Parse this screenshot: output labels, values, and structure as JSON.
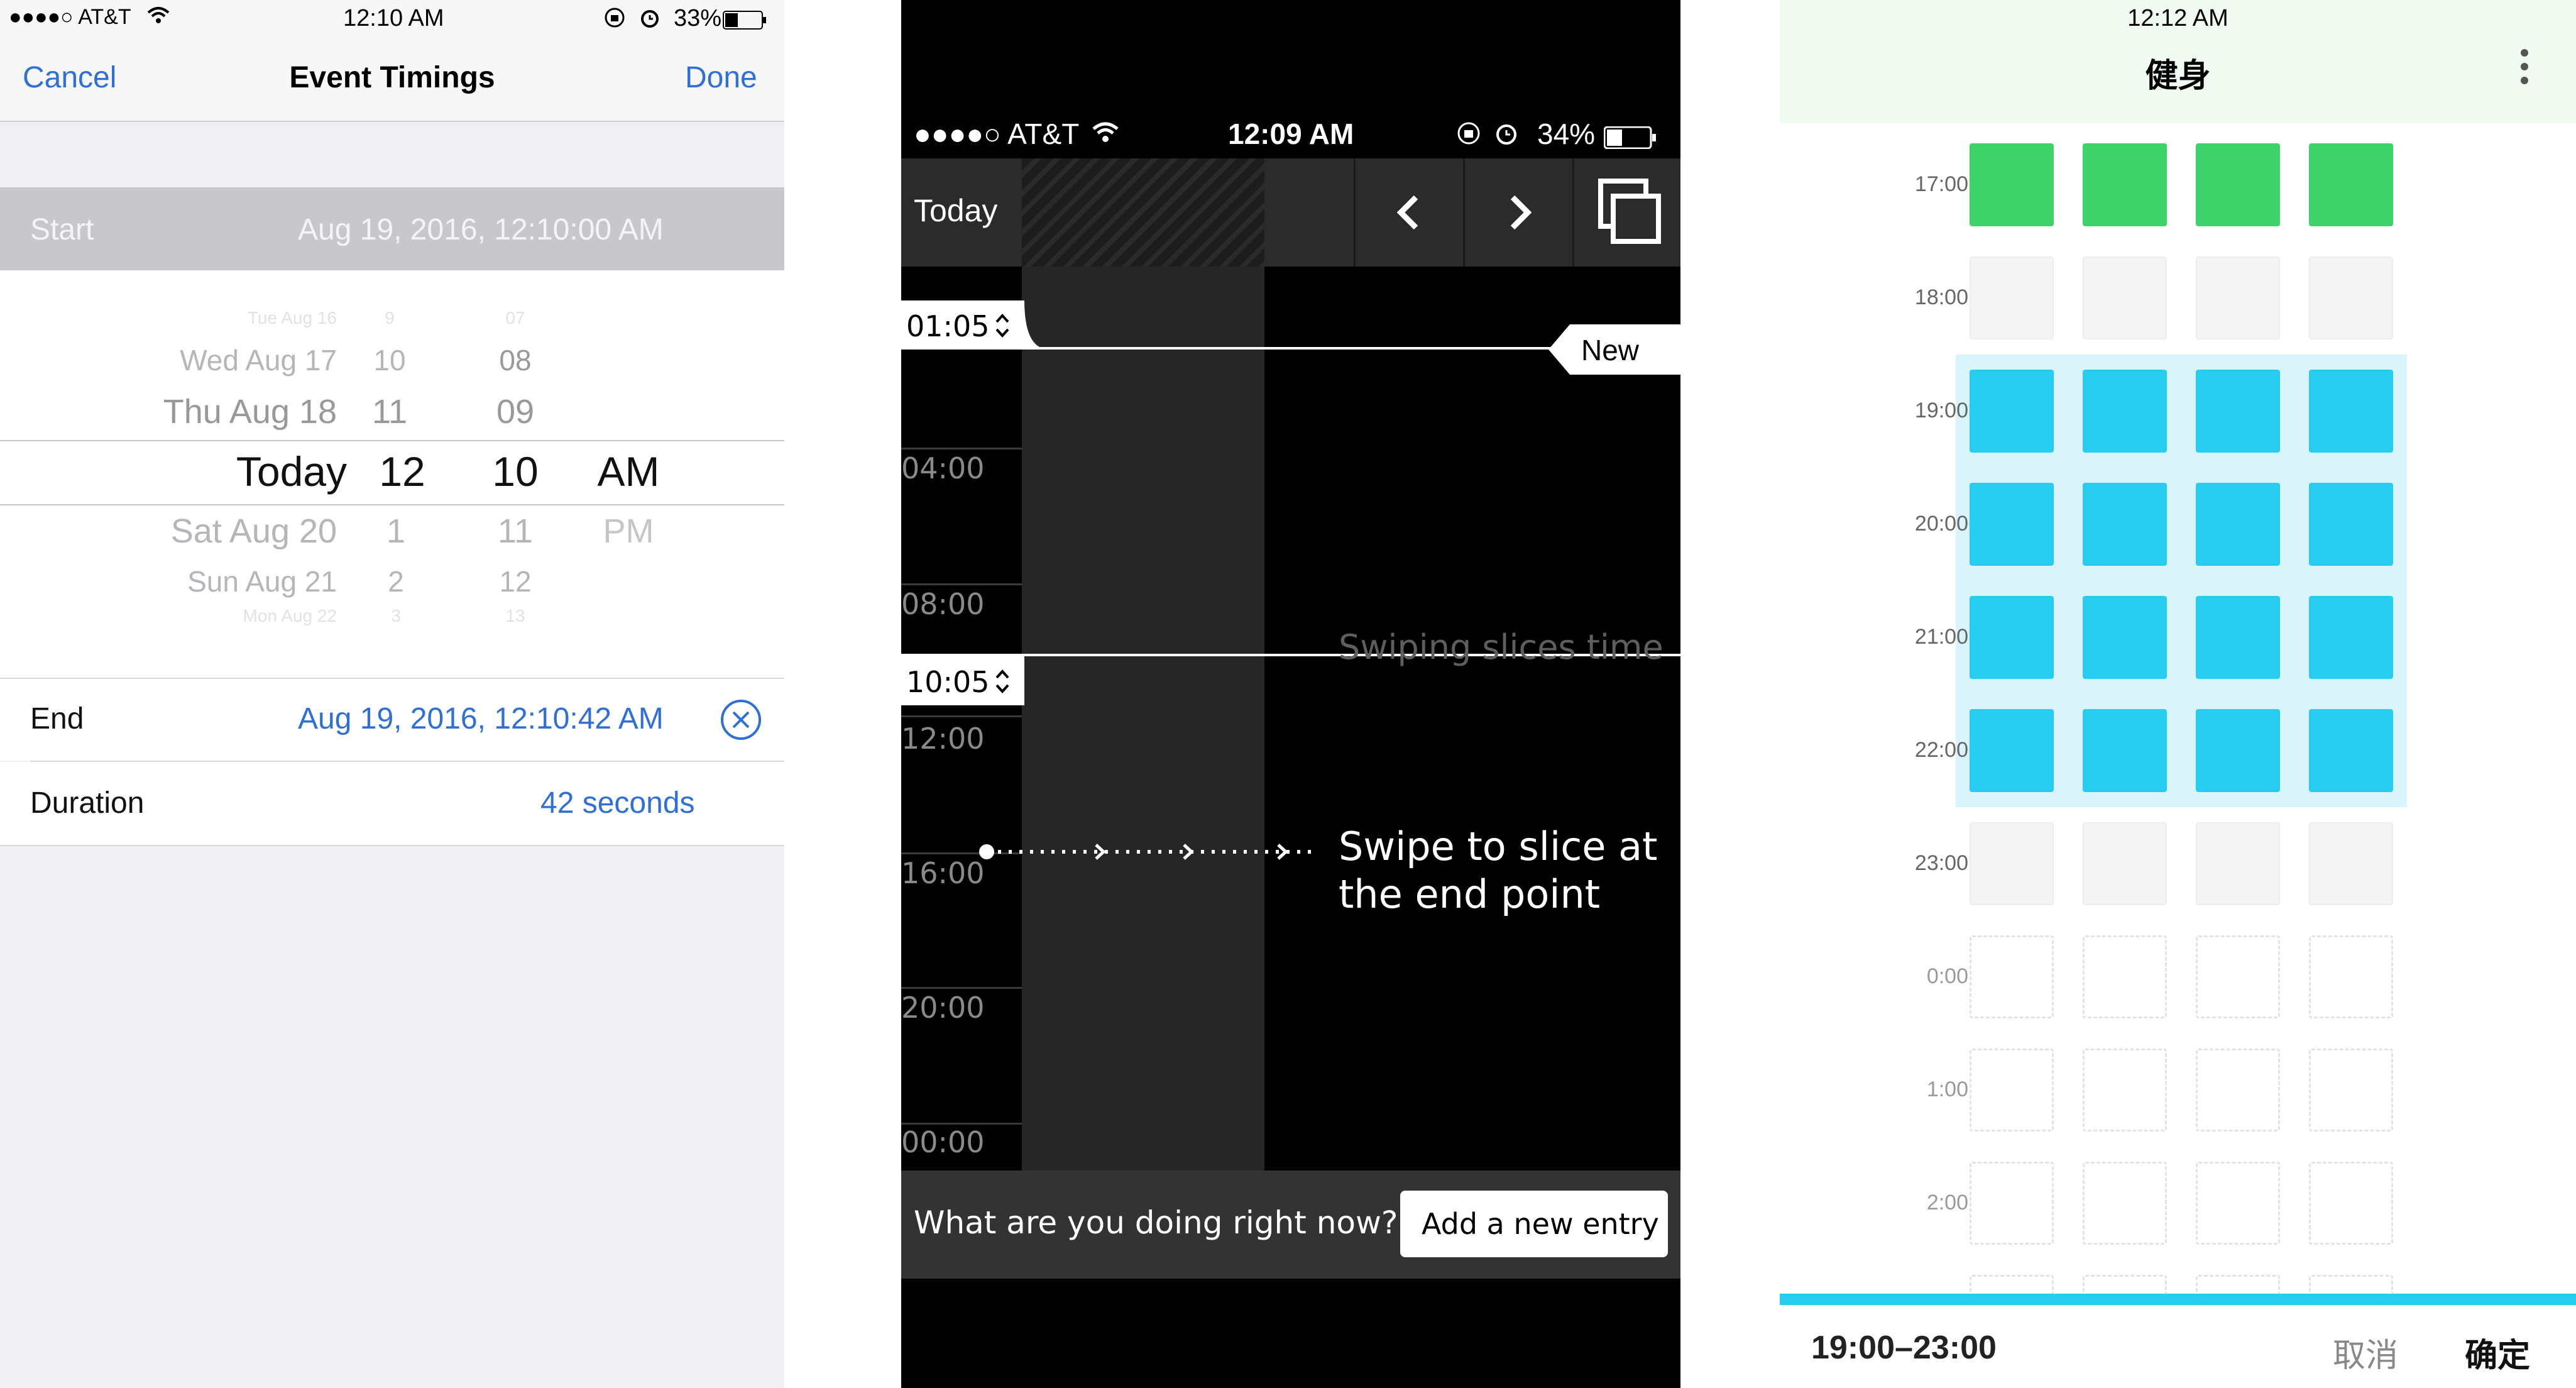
{
  "phone1": {
    "status": {
      "carrier": "●●●●○ AT&T",
      "time": "12:10 AM",
      "battery": "33%"
    },
    "nav": {
      "cancel": "Cancel",
      "title": "Event Timings",
      "done": "Done"
    },
    "start": {
      "label": "Start",
      "value": "Aug 19, 2016, 12:10:00 AM"
    },
    "picker": {
      "day_col": [
        "Tue Aug 16",
        "Wed Aug 17",
        "Thu Aug 18",
        "Today",
        "Sat Aug 20",
        "Sun Aug 21",
        "Mon Aug 22"
      ],
      "hour_col": [
        "9",
        "10",
        "11",
        "12",
        "1",
        "2",
        "3"
      ],
      "minute_col": [
        "07",
        "08",
        "09",
        "10",
        "11",
        "12",
        "13"
      ],
      "ampm_col": [
        "AM",
        "PM"
      ]
    },
    "end": {
      "label": "End",
      "value": "Aug 19, 2016, 12:10:42 AM"
    },
    "duration": {
      "label": "Duration",
      "value": "42 seconds"
    }
  },
  "phone2": {
    "status": {
      "carrier": "●●●●○ AT&T",
      "time": "12:09 AM",
      "battery": "34%"
    },
    "toolbar": {
      "today": "Today"
    },
    "pill_top": "01:05",
    "pill_mid": "10:05",
    "new_tag": "New",
    "hours": [
      "04:00",
      "08:00",
      "12:00",
      "16:00",
      "20:00",
      "00:00"
    ],
    "hint_slice": "Swiping slices time",
    "hint_end_line1": "Swipe to slice at",
    "hint_end_line2": "the end point",
    "bottom": {
      "question": "What are you doing right now?",
      "add_button": "Add a new entry"
    }
  },
  "phone3": {
    "status_time": "12:12 AM",
    "title": "健身",
    "hours": [
      "17:00",
      "18:00",
      "19:00",
      "20:00",
      "21:00",
      "22:00",
      "23:00",
      "0:00",
      "1:00",
      "2:00"
    ],
    "row_states": [
      "done",
      "empty",
      "selected",
      "selected",
      "selected",
      "selected",
      "empty",
      "future",
      "future",
      "future",
      "future"
    ],
    "footer": {
      "range": "19:00–23:00",
      "cancel": "取消",
      "confirm": "确定"
    },
    "colors": {
      "done": "#3ed46b",
      "selected": "#27ccef",
      "selected_bg": "#d9f4fb"
    }
  }
}
